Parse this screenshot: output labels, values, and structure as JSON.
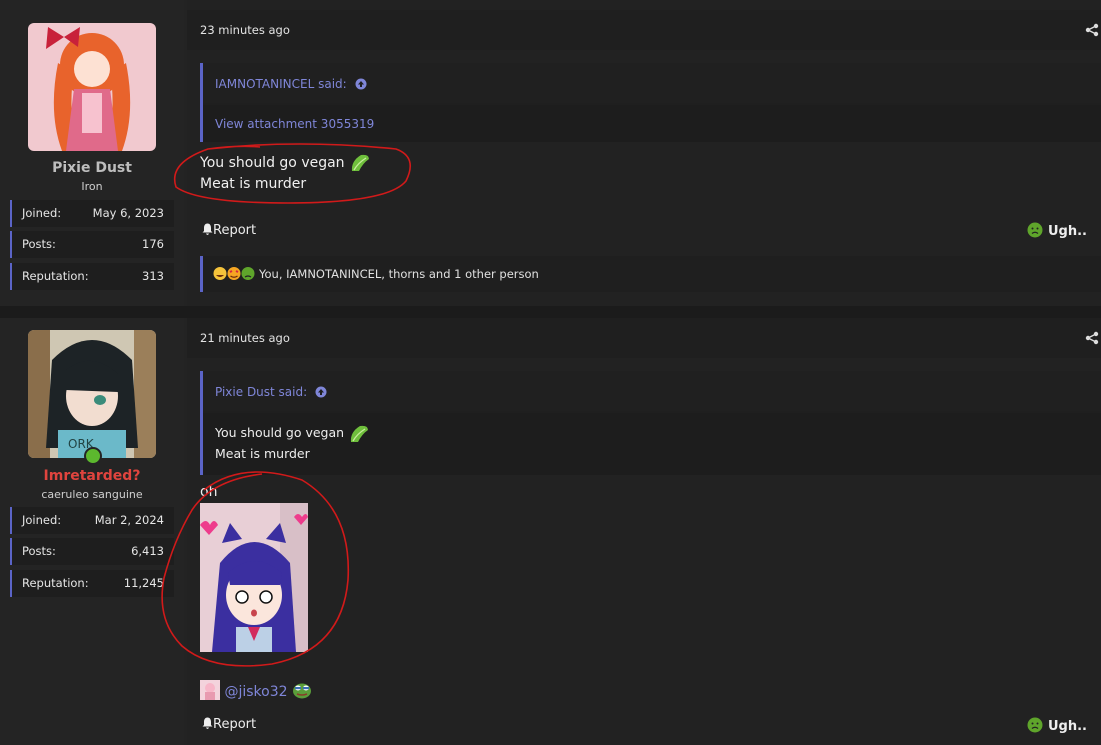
{
  "posts": [
    {
      "user": {
        "name": "Pixie Dust",
        "title": "Iron",
        "name_color": "#bdbdbd"
      },
      "stats": [
        {
          "label": "Joined:",
          "value": "May 6, 2023"
        },
        {
          "label": "Posts:",
          "value": "176"
        },
        {
          "label": "Reputation:",
          "value": "313"
        }
      ],
      "timestamp": "23 minutes ago",
      "quote": {
        "author": "IAMNOTANINCEL said:",
        "link": "View attachment 3055319"
      },
      "body": [
        "You should go vegan",
        "Meat is murder"
      ],
      "report_label": "Report",
      "reaction_label": "Ugh..",
      "reactions_by": "You, IAMNOTANINCEL, thorns and 1 other person"
    },
    {
      "user": {
        "name": "Imretarded?",
        "title": "caeruleo sanguine",
        "name_color": "#e0443e"
      },
      "stats": [
        {
          "label": "Joined:",
          "value": "Mar 2, 2024"
        },
        {
          "label": "Posts:",
          "value": "6,413"
        },
        {
          "label": "Reputation:",
          "value": "11,245"
        }
      ],
      "timestamp": "21 minutes ago",
      "quote": {
        "author": "Pixie Dust said:",
        "lines": [
          "You should go vegan",
          "Meat is murder"
        ]
      },
      "body": [
        "oh"
      ],
      "mention": "@jisko32",
      "report_label": "Report",
      "reaction_label": "Ugh.."
    }
  ],
  "colors": {
    "accent": "#5b64c7",
    "link": "#7f86d8",
    "annotation": "#d11a1a",
    "online": "#5cb82e"
  }
}
